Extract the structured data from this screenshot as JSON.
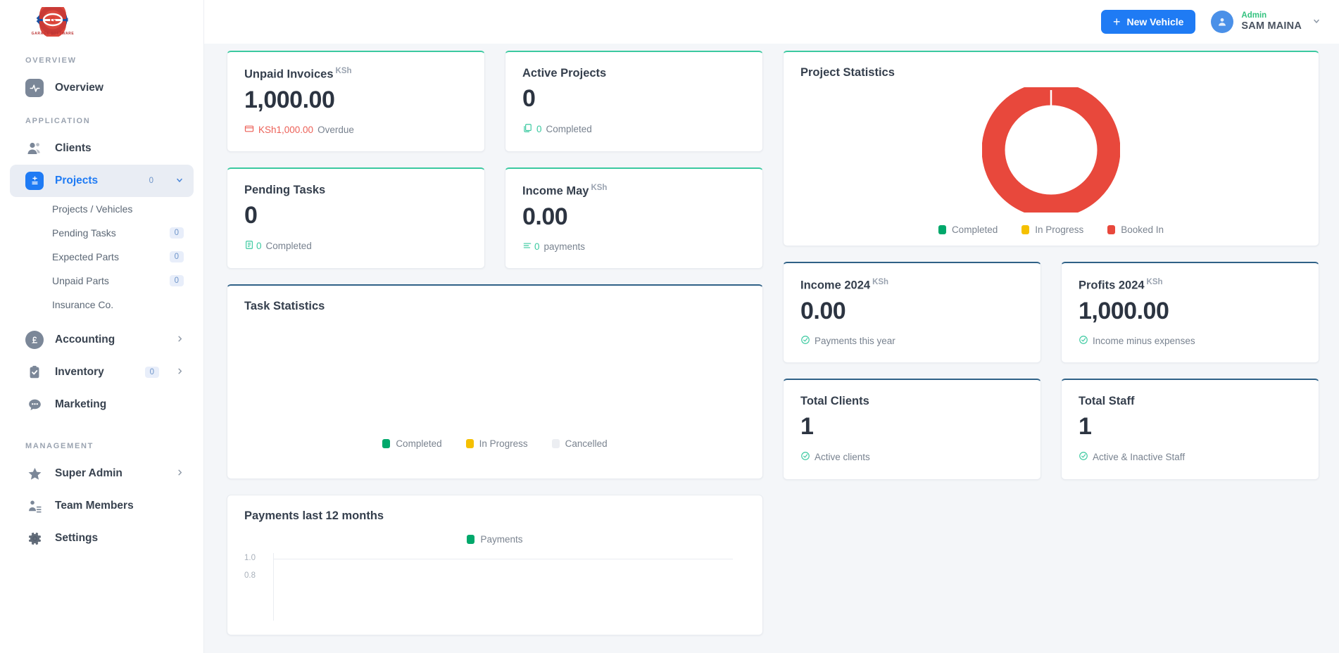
{
  "brand": {
    "logo_text": "GARAGE SOFTWARE"
  },
  "sidebar": {
    "sections": [
      {
        "label": "OVERVIEW"
      },
      {
        "label": "APPLICATION"
      },
      {
        "label": "MANAGEMENT"
      }
    ],
    "overview": {
      "label": "Overview"
    },
    "clients": {
      "label": "Clients"
    },
    "projects": {
      "label": "Projects",
      "badge": "0"
    },
    "sub": [
      {
        "label": "Projects / Vehicles",
        "badge": ""
      },
      {
        "label": "Pending Tasks",
        "badge": "0"
      },
      {
        "label": "Expected Parts",
        "badge": "0"
      },
      {
        "label": "Unpaid Parts",
        "badge": "0"
      },
      {
        "label": "Insurance Co.",
        "badge": ""
      }
    ],
    "accounting": {
      "label": "Accounting"
    },
    "inventory": {
      "label": "Inventory",
      "badge": "0"
    },
    "marketing": {
      "label": "Marketing"
    },
    "super_admin": {
      "label": "Super Admin"
    },
    "team_members": {
      "label": "Team Members"
    },
    "settings": {
      "label": "Settings"
    }
  },
  "topbar": {
    "new_vehicle": "New Vehicle",
    "user_role": "Admin",
    "user_name": "SAM MAINA"
  },
  "cards": {
    "unpaid_invoices": {
      "title": "Unpaid Invoices",
      "currency": "KSh",
      "value": "1,000.00",
      "foot_amount": "KSh1,000.00",
      "foot_text": "Overdue"
    },
    "active_projects": {
      "title": "Active Projects",
      "value": "0",
      "foot_count": "0",
      "foot_text": "Completed"
    },
    "pending_tasks": {
      "title": "Pending Tasks",
      "value": "0",
      "foot_count": "0",
      "foot_text": "Completed"
    },
    "income_may": {
      "title": "Income May",
      "currency": "KSh",
      "value": "0.00",
      "foot_count": "0",
      "foot_text": "payments"
    },
    "income_2024": {
      "title": "Income 2024",
      "currency": "KSh",
      "value": "0.00",
      "foot_text": "Payments this year"
    },
    "profits_2024": {
      "title": "Profits 2024",
      "currency": "KSh",
      "value": "1,000.00",
      "foot_text": "Income minus expenses"
    },
    "total_clients": {
      "title": "Total Clients",
      "value": "1",
      "foot_text": "Active clients"
    },
    "total_staff": {
      "title": "Total Staff",
      "value": "1",
      "foot_text": "Active & Inactive Staff"
    }
  },
  "panels": {
    "project_statistics": "Project Statistics",
    "task_statistics": "Task Statistics",
    "payments_12": "Payments last 12 months"
  },
  "colors": {
    "accent_blue": "#1f7bf4",
    "teal": "#3bc9a0",
    "slate": "#2f6187",
    "green": "#00a86b",
    "yellow": "#f5c000",
    "red": "#e8483c",
    "gray": "#eceef2"
  },
  "chart_data": [
    {
      "type": "pie",
      "title": "Project Statistics",
      "categories": [
        "Completed",
        "In Progress",
        "Booked In"
      ],
      "values": [
        0,
        0,
        1
      ],
      "colors": [
        "#00a86b",
        "#f5c000",
        "#e8483c"
      ],
      "legend_position": "bottom",
      "donut": true
    },
    {
      "type": "pie",
      "title": "Task Statistics",
      "categories": [
        "Completed",
        "In Progress",
        "Cancelled"
      ],
      "values": [
        0,
        0,
        0
      ],
      "colors": [
        "#00a86b",
        "#f5c000",
        "#eceef2"
      ],
      "legend_position": "bottom",
      "donut": true
    },
    {
      "type": "bar",
      "title": "Payments last 12 months",
      "categories": [],
      "series": [
        {
          "name": "Payments",
          "values": []
        }
      ],
      "colors": [
        "#00a86b"
      ],
      "yticks": [
        "1.0",
        "0.8"
      ],
      "ylim": [
        0,
        1
      ],
      "grid": true,
      "legend_position": "top"
    }
  ]
}
